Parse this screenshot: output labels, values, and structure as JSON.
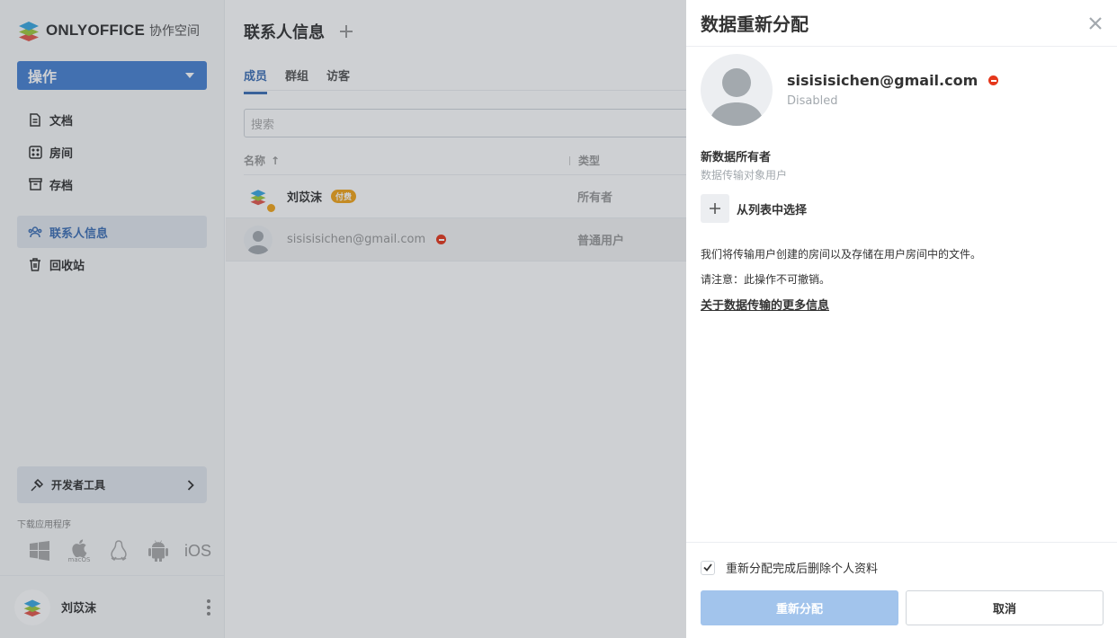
{
  "sidebar": {
    "brand": "ONLYOFFICE",
    "brand_sub": "协作空间",
    "action_label": "操作",
    "nav": [
      {
        "label": "文档",
        "icon": "document-icon"
      },
      {
        "label": "房间",
        "icon": "rooms-icon"
      },
      {
        "label": "存档",
        "icon": "archive-icon"
      },
      {
        "label": "联系人信息",
        "icon": "contacts-icon",
        "active": true
      },
      {
        "label": "回收站",
        "icon": "trash-icon"
      }
    ],
    "dev_tools": "开发者工具",
    "download_label": "下载应用程序",
    "apps": {
      "macos": "macOS",
      "ios": "iOS"
    },
    "user_name": "刘苡沫"
  },
  "main": {
    "title": "联系人信息",
    "tabs": [
      "成员",
      "群组",
      "访客"
    ],
    "search_placeholder": "搜索",
    "columns": {
      "name": "名称",
      "sort": "↑",
      "type": "类型"
    },
    "rows": [
      {
        "name": "刘苡沫",
        "badge": "付费",
        "type": "所有者"
      },
      {
        "name": "sisisisichen@gmail.com",
        "type": "普通用户"
      }
    ]
  },
  "panel": {
    "title": "数据重新分配",
    "user_email": "sisisisichen@gmail.com",
    "user_status": "Disabled",
    "new_owner_title": "新数据所有者",
    "new_owner_sub": "数据传输对象用户",
    "select_from_list": "从列表中选择",
    "note1": "我们将传输用户创建的房间以及存储在用户房间中的文件。",
    "note2": "请注意：此操作不可撤销。",
    "more_link": "关于数据传输的更多信息",
    "delete_profile_label": "重新分配完成后删除个人资料",
    "delete_profile_checked": true,
    "reassign_button": "重新分配",
    "cancel_button": "取消"
  },
  "colors": {
    "accent": "#4781d1",
    "active_nav": "#3d6fb5",
    "disabled_badge": "#e5371b",
    "paid_badge": "#f2a51a",
    "primary_disabled": "#a2c4ec"
  }
}
